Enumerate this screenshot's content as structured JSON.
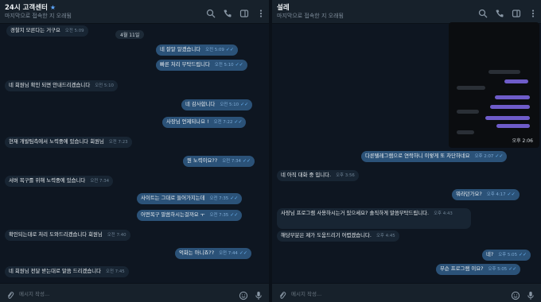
{
  "left": {
    "name": "24시 고객센터",
    "sub": "마지막으로 접속한 지 오래됨",
    "date": "4월 11일",
    "composer_placeholder": "메시지 작성...",
    "messages": [
      {
        "text": "경찰지 모른다는 거구요",
        "time": "오전 5:09",
        "dir": "in"
      },
      {
        "text": "네 잘알 알겠습니다",
        "time": "오전 5:09",
        "dir": "out"
      },
      {
        "text": "빠른 처리 부탁드립니다",
        "time": "오전 5:10",
        "dir": "out"
      },
      {
        "text": "네 회원님 확인 되면 안내드리겠습니다",
        "time": "오전 5:10",
        "dir": "in"
      },
      {
        "text": "네 감사합니다",
        "time": "오전 5:10",
        "dir": "out"
      },
      {
        "text": "사장님 언제되나요 !",
        "time": "오전 7:22",
        "dir": "out"
      },
      {
        "text": "현재 개발팀측에서 노력중에 있습니다 회원님",
        "time": "오전 7:23",
        "dir": "in"
      },
      {
        "text": "뭔 노력이요??",
        "time": "오전 7:34",
        "dir": "out"
      },
      {
        "text": "서버 복구를 위해 노력중에 있습니다",
        "time": "오전 7:34",
        "dir": "in"
      },
      {
        "text": "사이트는 그대로 들어가지는데",
        "time": "오전 7:35",
        "dir": "out"
      },
      {
        "text": "어떤복구 말씀하시는걸까요 ㅜ",
        "time": "오전 7:35",
        "dir": "out"
      },
      {
        "text": "확인되는대로 처리 도와드리겠습니다 회원님",
        "time": "오전 7:40",
        "dir": "in"
      },
      {
        "text": "억화는 아니죠??",
        "time": "오전 7:44",
        "dir": "out"
      },
      {
        "text": "네 회원님 전달 받는대로 말씀 드리겠습니다",
        "time": "오전 7:45",
        "dir": "in"
      }
    ]
  },
  "right": {
    "name": "설레",
    "sub": "마지막으로 접속한 지 오래됨",
    "screenshot_time": "오후 2:06",
    "composer_placeholder": "메시지 작성...",
    "messages": [
      {
        "text": "다른텔레그램으로 연락하니 이렇게 또 차단하네요",
        "time": "오후 2:07",
        "dir": "out"
      },
      {
        "text": "네 아직 대화 중 입니다.",
        "time": "오후 3:56",
        "dir": "in"
      },
      {
        "text": "뭐라던가요?",
        "time": "오후 4:17",
        "dir": "out"
      },
      {
        "text": "사장님 프로그램 사용하시는거 있으세요? 솔직하게 말씀부탁드립니다.",
        "time": "오후 4:43",
        "dir": "in"
      },
      {
        "text": "해당부분은 제가 도움드리기 어렵겠습니다.",
        "time": "오후 4:45",
        "dir": "in"
      },
      {
        "text": "네?",
        "time": "오후 5:05",
        "dir": "out"
      },
      {
        "text": "무슨 프로그램 이요?",
        "time": "오후 5:05",
        "dir": "out"
      }
    ]
  },
  "colors": {
    "background": "#0e1621",
    "header": "#17212b",
    "incoming": "#182533",
    "outgoing": "#2b5278",
    "accent": "#6ab3f3"
  },
  "icons": [
    "search-icon",
    "phone-icon",
    "sidebar-icon",
    "more-icon",
    "attach-icon",
    "emoji-icon",
    "mic-icon",
    "verified-star-icon"
  ]
}
